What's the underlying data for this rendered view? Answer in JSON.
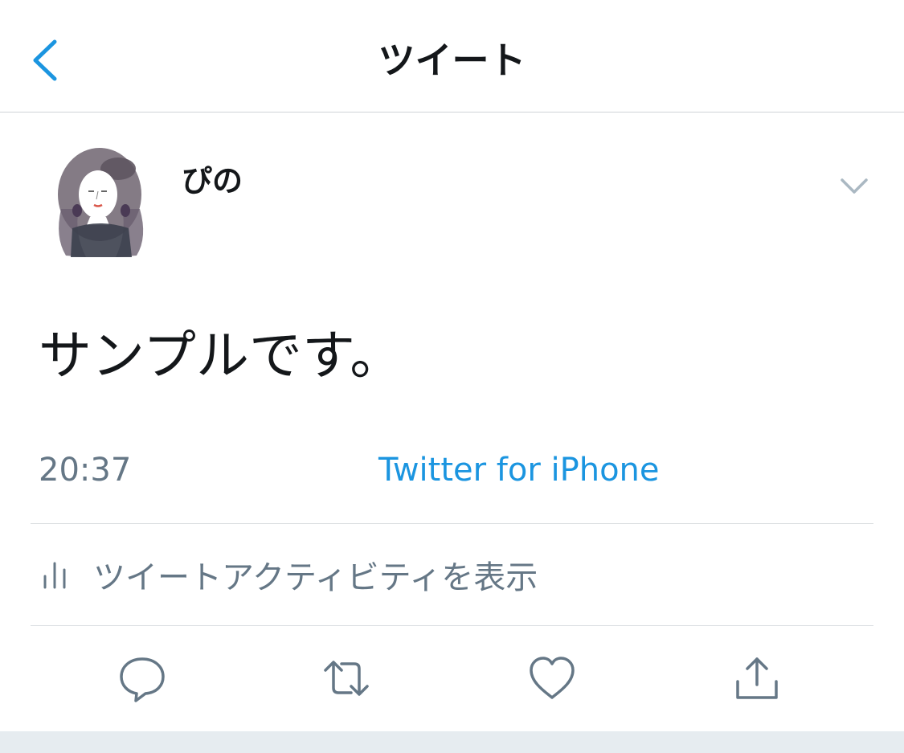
{
  "header": {
    "title": "ツイート",
    "back_icon": "chevron-left-icon"
  },
  "tweet": {
    "user_name": "ぴの",
    "handle": "",
    "text": "サンプルです。",
    "time": "20:37",
    "source": "Twitter for iPhone"
  },
  "activity": {
    "label": "ツイートアクティビティを表示",
    "icon": "bar-chart-icon"
  },
  "actions": {
    "icons": [
      "reply-icon",
      "retweet-icon",
      "like-icon",
      "share-icon"
    ]
  },
  "colors": {
    "accent": "#1b95e0",
    "secondary_text": "#657786",
    "primary_text": "#14171a",
    "divider": "#dcdfe2",
    "icon_gray": "#657786",
    "footer_bg": "#e6ecf0"
  }
}
